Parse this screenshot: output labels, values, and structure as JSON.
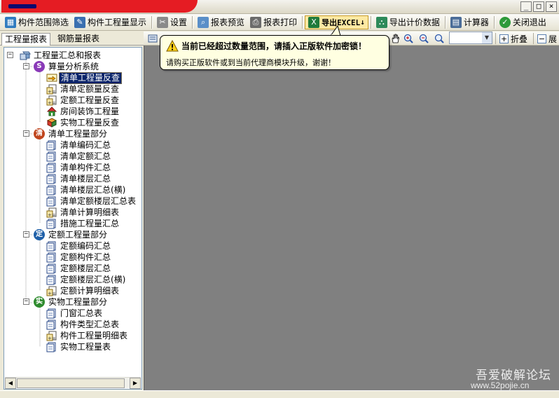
{
  "window": {
    "controls": {
      "minimize": "_",
      "restore": "□",
      "close": "×"
    }
  },
  "toolbar": {
    "filter_label": "构件范围筛选",
    "display_label": "构件工程量显示",
    "settings_label": "设置",
    "preview_label": "报表预览",
    "print_label": "报表打印",
    "excel_label": "导出EXCEL",
    "excel_arrow": "↓",
    "export_price_label": "导出计价数据",
    "calculator_label": "计算器",
    "close_exit_label": "关闭退出"
  },
  "tabs": [
    {
      "label": "工程量报表",
      "selected": true
    },
    {
      "label": "钢筋量报表",
      "selected": false
    }
  ],
  "toolbar2": {
    "fold_label": "折叠",
    "expand_label": "展"
  },
  "balloon": {
    "title": "当前已经超过数量范围，请插入正版软件加密锁！",
    "message": "请购买正版软件或到当前代理商模块升级，谢谢！"
  },
  "tree": {
    "root": {
      "label": "工程量汇总和报表",
      "icon": "report-root-icon"
    },
    "groups": [
      {
        "label": "算量分析系统",
        "badge": "S",
        "badge_color": "#8a3ab8",
        "items": [
          {
            "label": "清单工程量反查",
            "icon": "hand-pointer-icon",
            "selected": true
          },
          {
            "label": "清单定额量反查",
            "icon": "calc-sheet-icon"
          },
          {
            "label": "定额工程量反查",
            "icon": "calc-sheet-icon"
          },
          {
            "label": "房间装饰工程量",
            "icon": "house-icon"
          },
          {
            "label": "实物工程量反查",
            "icon": "cube-icon"
          }
        ]
      },
      {
        "label": "清单工程量部分",
        "badge": "清",
        "badge_color": "#c0461e",
        "items": [
          {
            "label": "清单编码汇总",
            "icon": "sheet-icon"
          },
          {
            "label": "清单定额汇总",
            "icon": "sheet-icon"
          },
          {
            "label": "清单构件汇总",
            "icon": "sheet-icon"
          },
          {
            "label": "清单楼层汇总",
            "icon": "sheet-icon"
          },
          {
            "label": "清单楼层汇总(横)",
            "icon": "sheet-icon"
          },
          {
            "label": "清单定额楼层汇总表",
            "icon": "sheet-icon"
          },
          {
            "label": "清单计算明细表",
            "icon": "calc-sheet-icon"
          },
          {
            "label": "措施工程量汇总",
            "icon": "sheet-icon"
          }
        ]
      },
      {
        "label": "定额工程量部分",
        "badge": "定",
        "badge_color": "#1e5fa8",
        "items": [
          {
            "label": "定额编码汇总",
            "icon": "sheet-icon"
          },
          {
            "label": "定额构件汇总",
            "icon": "sheet-icon"
          },
          {
            "label": "定额楼层汇总",
            "icon": "sheet-icon"
          },
          {
            "label": "定额楼层汇总(横)",
            "icon": "sheet-icon"
          },
          {
            "label": "定额计算明细表",
            "icon": "calc-sheet-icon"
          }
        ]
      },
      {
        "label": "实物工程量部分",
        "badge": "实",
        "badge_color": "#2e8b2e",
        "items": [
          {
            "label": "门窗汇总表",
            "icon": "sheet-icon"
          },
          {
            "label": "构件类型汇总表",
            "icon": "sheet-icon"
          },
          {
            "label": "构件工程量明细表",
            "icon": "calc-sheet-icon"
          },
          {
            "label": "实物工程量表",
            "icon": "sheet-icon"
          }
        ]
      }
    ]
  },
  "watermark": {
    "title": "吾爱破解论坛",
    "url": "www.52pojie.cn"
  }
}
